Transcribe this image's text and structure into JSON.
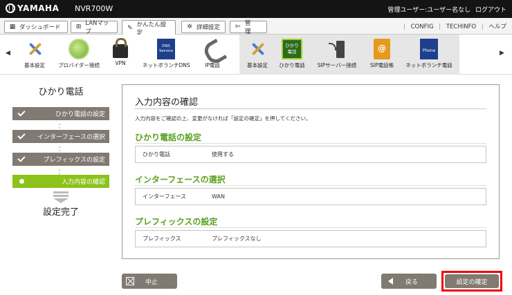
{
  "header": {
    "brand": "YAMAHA",
    "model": "NVR700W",
    "user_label": "管理ユーザー:ユーザー名なし",
    "logout": "ログアウト"
  },
  "tabs": [
    {
      "label": "ダッシュボード",
      "icon": "dashboard-icon"
    },
    {
      "label": "LANマップ",
      "icon": "lan-map-icon"
    },
    {
      "label": "かんたん設定",
      "icon": "wizard-icon",
      "active": true
    },
    {
      "label": "詳細設定",
      "icon": "gear-icon"
    },
    {
      "label": "管　理",
      "icon": "wrench-icon"
    }
  ],
  "tab_links": [
    "CONFIG",
    "TECHINFO",
    "ヘルプ"
  ],
  "icon_bar": {
    "items": [
      {
        "label": "基本設定",
        "icon": "tools-icon"
      },
      {
        "label": "プロバイダー接続",
        "icon": "globe-icon"
      },
      {
        "label": "VPN",
        "icon": "lock-icon"
      },
      {
        "label": "ネットボランチDNS",
        "icon": "dns-service-icon",
        "badge": "DNS Service"
      },
      {
        "label": "IP電話",
        "icon": "phone-icon"
      },
      {
        "label": "基本設定",
        "icon": "tools-icon"
      },
      {
        "label": "ひかり電話",
        "icon": "hikari-denwa-icon",
        "badge": "ひかり 電話",
        "active": true
      },
      {
        "label": "SIPサーバー接続",
        "icon": "sip-server-icon"
      },
      {
        "label": "SIP電話帳",
        "icon": "address-book-icon"
      },
      {
        "label": "ネットボランチ電話",
        "icon": "netvolante-phone-icon",
        "badge": "Phone"
      }
    ]
  },
  "steps": {
    "title": "ひかり電話",
    "items": [
      {
        "label": "ひかり電話の設定",
        "state": "done"
      },
      {
        "label": "インターフェースの選択",
        "state": "done"
      },
      {
        "label": "プレフィックスの設定",
        "state": "done"
      },
      {
        "label": "入力内容の確認",
        "state": "current"
      }
    ],
    "done_label": "設定完了"
  },
  "main": {
    "title": "入力内容の確認",
    "description": "入力内容をご確認の上、変更がなければ「設定の確定」を押してください。",
    "sections": [
      {
        "title": "ひかり電話の設定",
        "key": "ひかり電話",
        "value": "使用する"
      },
      {
        "title": "インターフェースの選択",
        "key": "インターフェース",
        "value": "WAN"
      },
      {
        "title": "プレフィックスの設定",
        "key": "プレフィックス",
        "value": "プレフィックスなし"
      }
    ]
  },
  "buttons": {
    "cancel": "中止",
    "back": "戻る",
    "confirm": "設定の確定"
  },
  "colors": {
    "topbar": "#141414",
    "accent_green": "#8cc21c",
    "section_green": "#5aa01e",
    "step_gray": "#807a73",
    "highlight_red": "#e00000"
  }
}
